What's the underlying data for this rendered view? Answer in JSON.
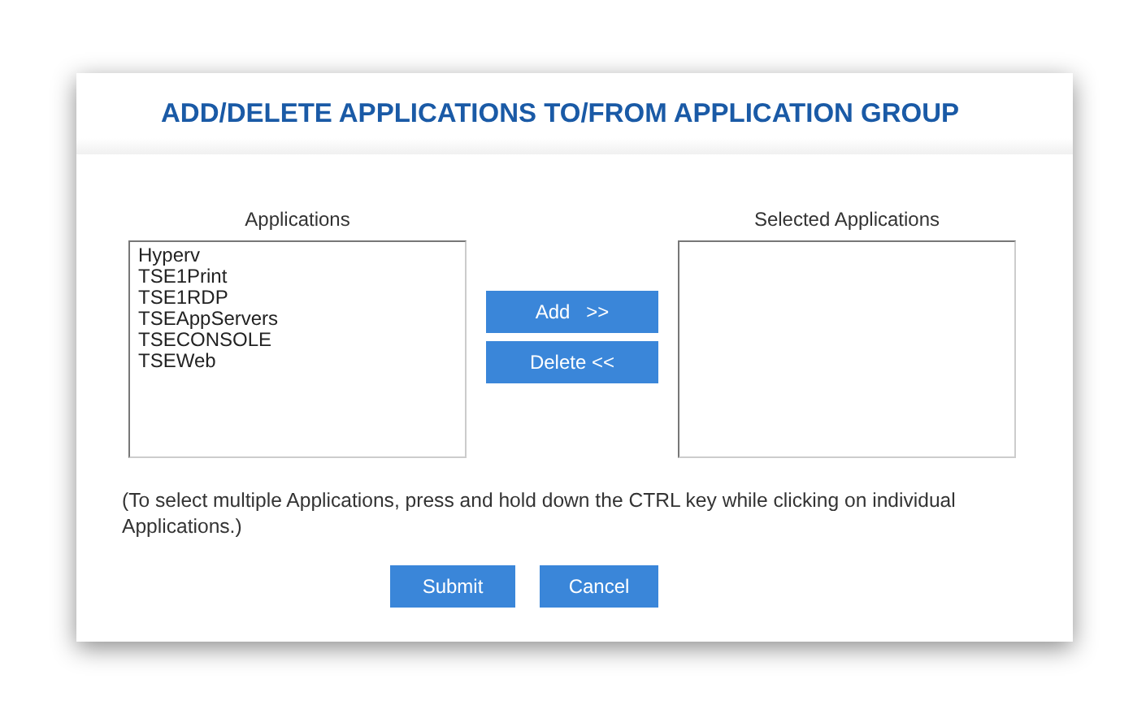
{
  "title": "ADD/DELETE APPLICATIONS TO/FROM APPLICATION GROUP",
  "available": {
    "label": "Applications",
    "items": [
      {
        "label": "Hyperv",
        "selected": false
      },
      {
        "label": "TSE1Print",
        "selected": false
      },
      {
        "label": "TSE1RDP",
        "selected": false
      },
      {
        "label": "TSEAppServers",
        "selected": false
      },
      {
        "label": "TSECONSOLE",
        "selected": false
      },
      {
        "label": "TSEWeb",
        "selected": false
      }
    ]
  },
  "selected_list": {
    "label": "Selected Applications"
  },
  "move_buttons": [
    "Add   >>",
    "Delete <<"
  ],
  "note": "(To select multiple Applications, press and hold down the CTRL key while clicking on individual Applications.)",
  "buttons": [
    "Submit",
    "Cancel"
  ]
}
